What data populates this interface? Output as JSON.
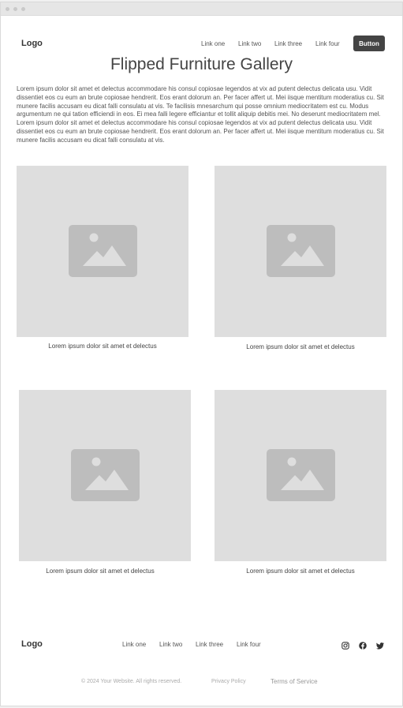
{
  "header": {
    "logo": "Logo",
    "links": [
      "Link one",
      "Link two",
      "Link three",
      "Link four"
    ],
    "button": "Button"
  },
  "main": {
    "title": "Flipped Furniture Gallery",
    "intro": "Lorem ipsum dolor sit amet et delectus accommodare his consul copiosae legendos at vix ad putent delectus delicata usu. Vidit dissentiet eos cu eum an brute copiosae hendrerit. Eos erant dolorum an. Per facer affert ut. Mei iisque mentitum moderatius cu. Sit munere facilis accusam eu dicat falli consulatu at vis. Te facilisis mnesarchum qui posse omnium mediocritatem est cu. Modus argumentum ne qui tation efficiendi in eos. Ei mea falli legere efficiantur et tollit aliquip debitis mei. No deserunt mediocritatem mel. Lorem ipsum dolor sit amet et delectus accommodare his consul copiosae legendos at vix ad putent delectus delicata usu. Vidit dissentiet eos cu eum an brute copiosae hendrerit. Eos erant dolorum an. Per facer affert ut. Mei iisque mentitum moderatius cu. Sit munere facilis accusam eu dicat falli consulatu at vis.",
    "gallery": [
      {
        "caption": "Lorem ipsum dolor sit amet et delectus",
        "icon": "image-placeholder-icon"
      },
      {
        "caption": "Lorem ipsum dolor sit amet et delectus",
        "icon": "image-placeholder-icon"
      },
      {
        "caption": "Lorem ipsum dolor sit amet et delectus",
        "icon": "image-placeholder-icon"
      },
      {
        "caption": "Lorem ipsum dolor sit amet et delectus",
        "icon": "image-placeholder-icon"
      }
    ]
  },
  "footer": {
    "logo": "Logo",
    "links": [
      "Link one",
      "Link two",
      "Link three",
      "Link four"
    ],
    "social": [
      "instagram-icon",
      "facebook-icon",
      "twitter-icon"
    ],
    "copyright": "© 2024 Your Website. All rights reserved.",
    "privacy": "Privacy Policy",
    "terms": "Terms of Service"
  },
  "colors": {
    "button_bg": "#444444",
    "placeholder_bg": "#dedede",
    "placeholder_icon": "#bdbdbd"
  }
}
